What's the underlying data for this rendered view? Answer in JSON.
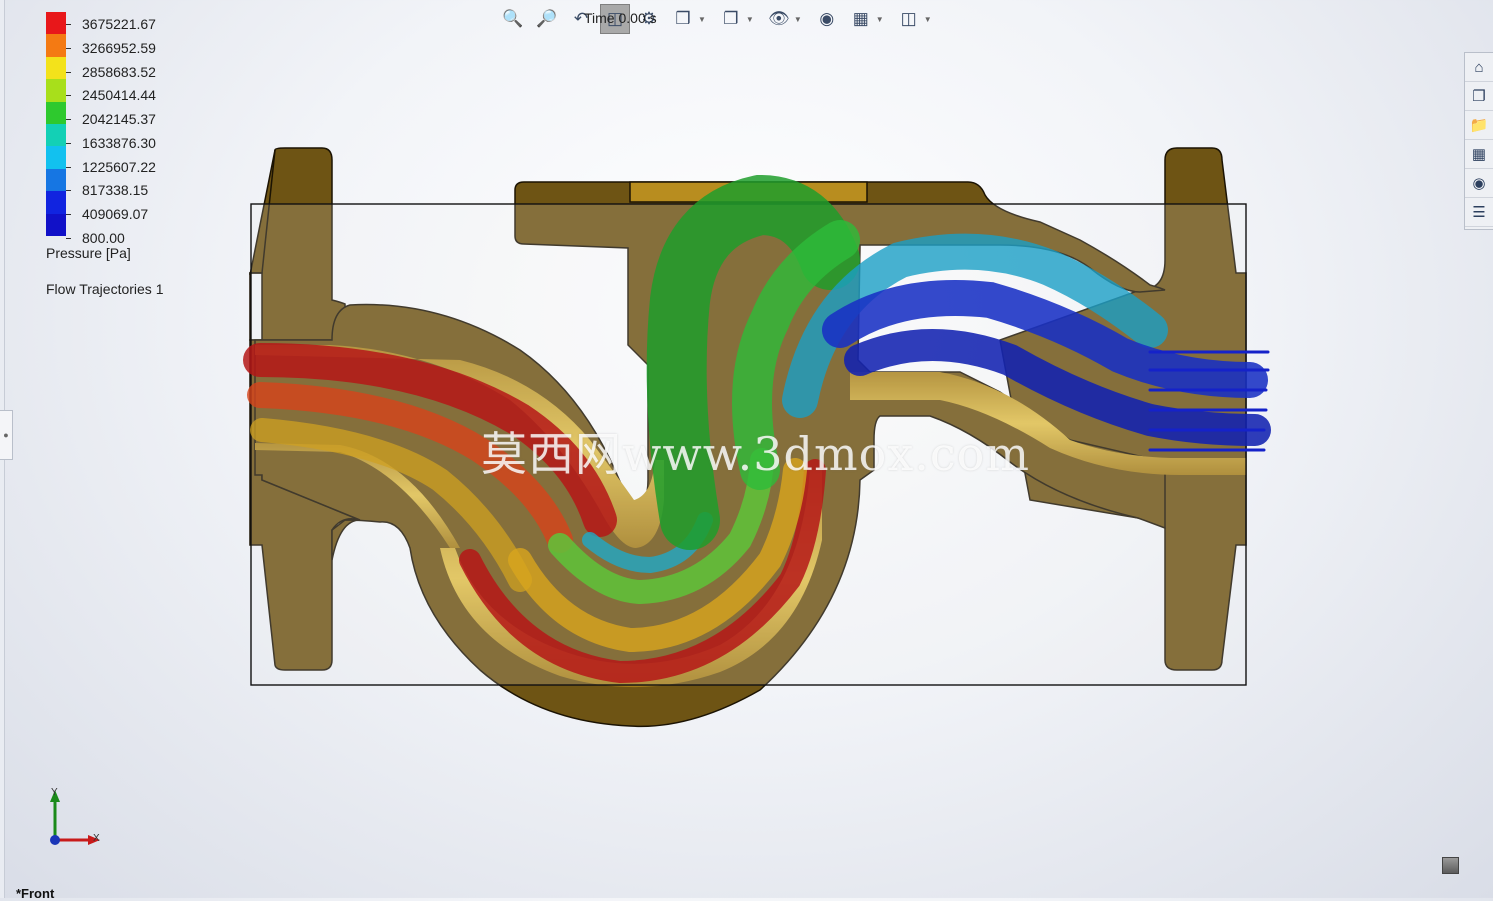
{
  "legend": {
    "colors": [
      "#e8171a",
      "#f47a13",
      "#f3e21b",
      "#a8df1b",
      "#2ec92e",
      "#13d0b5",
      "#12c1ef",
      "#1676e3",
      "#1124e0",
      "#1111c8"
    ],
    "values": [
      "3675221.67",
      "3266952.59",
      "2858683.52",
      "2450414.44",
      "2042145.37",
      "1633876.30",
      "1225607.22",
      "817338.15",
      "409069.07",
      "800.00"
    ],
    "title": "Pressure [Pa]"
  },
  "trajectories_label": "Flow Trajectories 1",
  "toolbar": {
    "time_text": "Time 0.00 s",
    "icons": [
      "zoom-to-fit-icon",
      "zoom-area-icon",
      "previous-view-icon",
      "section-view-icon",
      "dynamic-annotation-icon",
      "view-orientation-icon",
      "display-style-icon",
      "hide-show-icon",
      "edit-appearance-icon",
      "apply-scene-icon",
      "view-settings-icon"
    ]
  },
  "taskpane": {
    "icons": [
      "home-icon",
      "parts-icon",
      "folder-icon",
      "view-palette-icon",
      "appearance-icon",
      "custom-properties-icon"
    ]
  },
  "watermark": "莫西网www.3dmox.com",
  "triad": {
    "y": "Y",
    "x": "X"
  },
  "view_name": "*Front",
  "colors": {
    "casting": "#6e5414",
    "casting_dark": "#3d2d06",
    "bore": "#c9a12e"
  }
}
